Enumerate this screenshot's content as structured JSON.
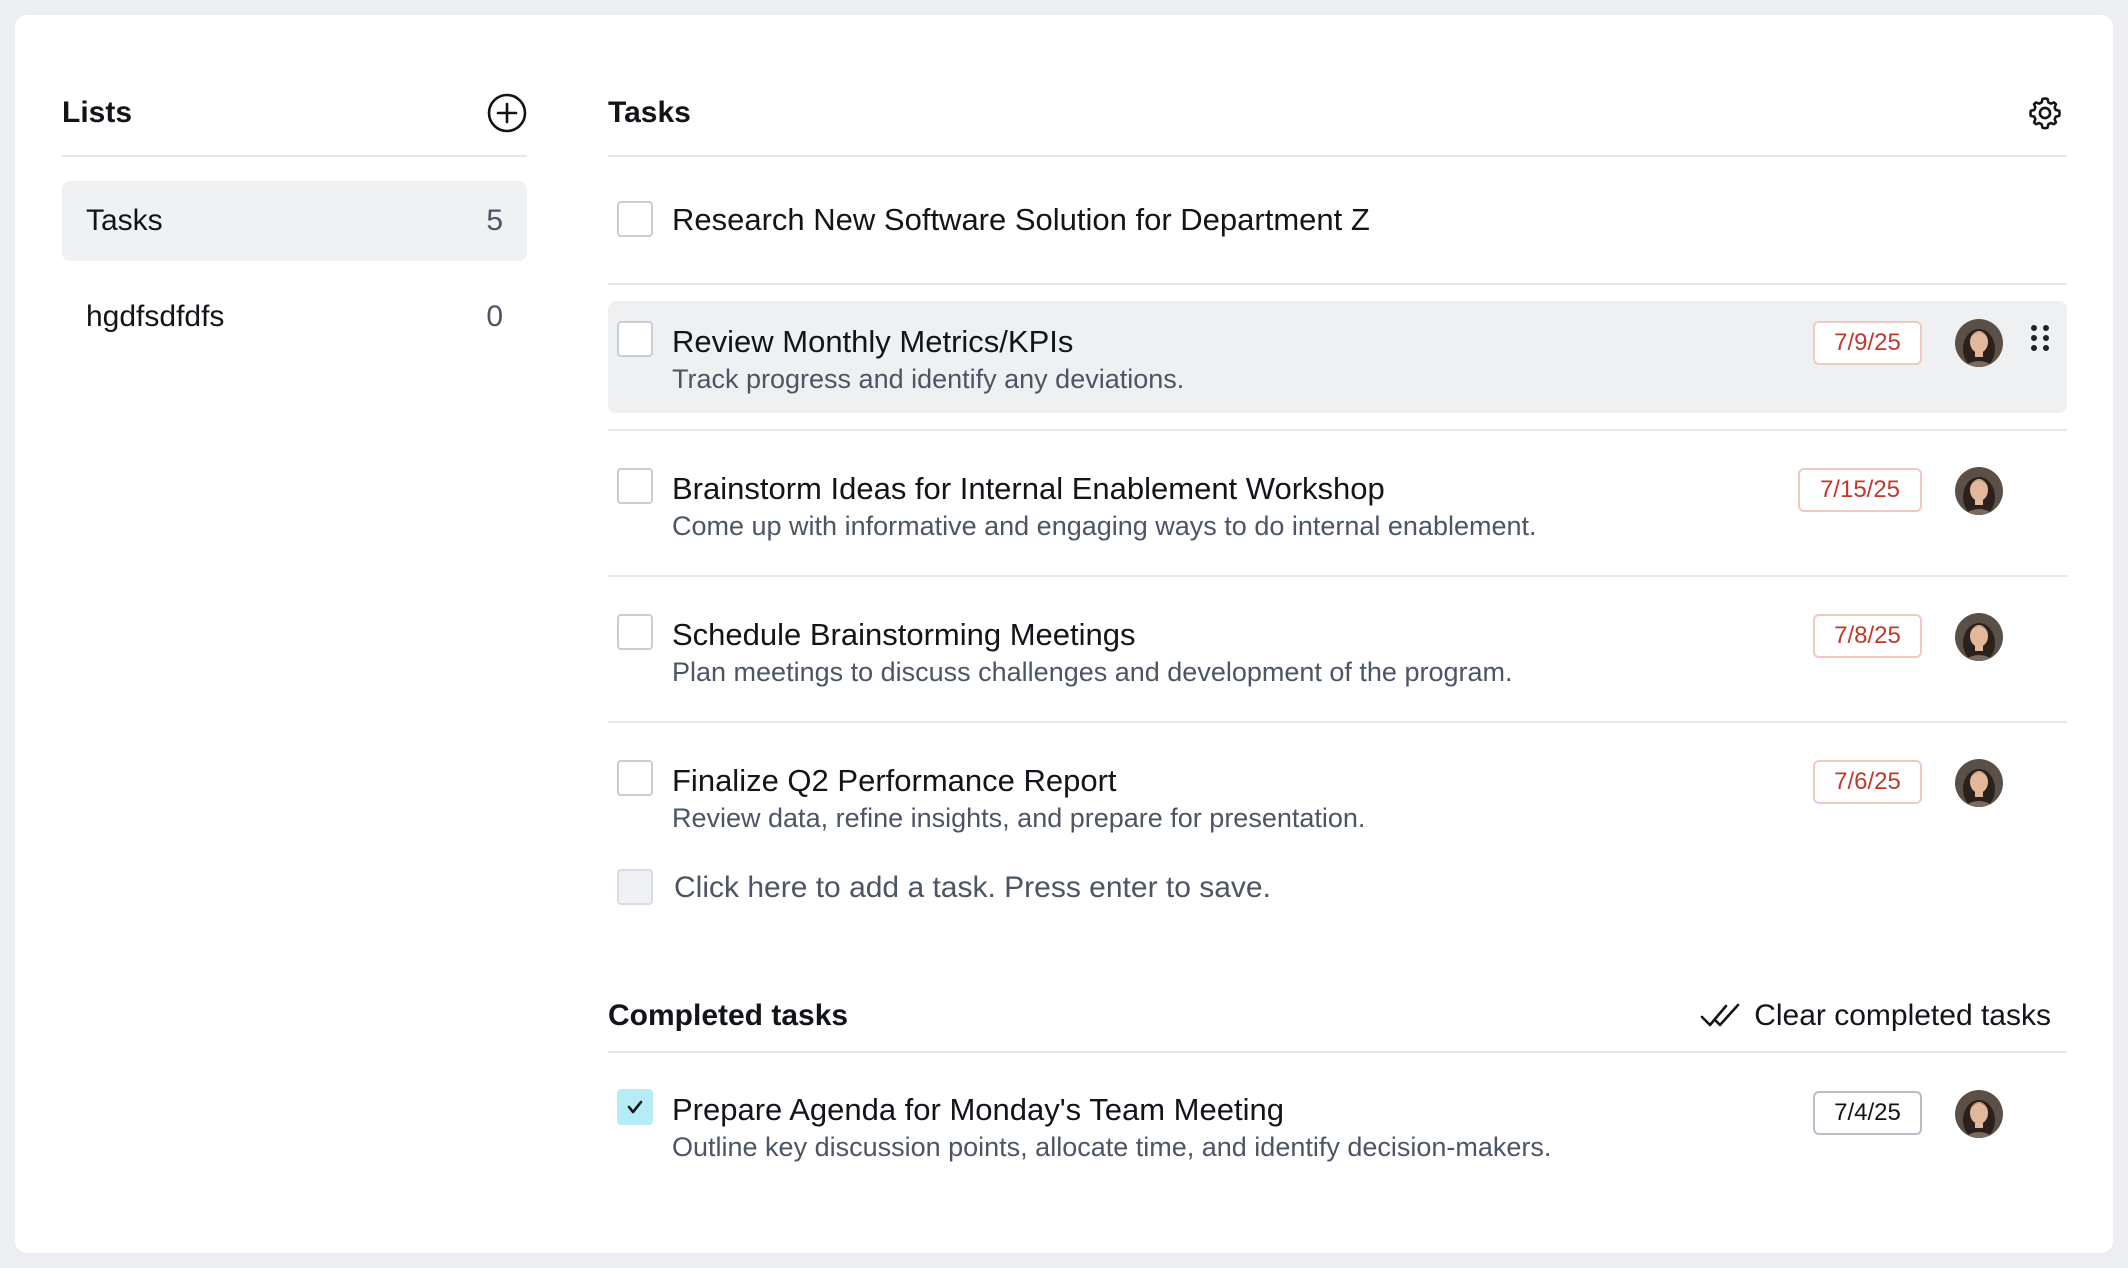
{
  "sidebar": {
    "title": "Lists",
    "add_icon": "plus-circle-icon",
    "items": [
      {
        "label": "Tasks",
        "count": "5",
        "active": true
      },
      {
        "label": "hgdfsdfdfs",
        "count": "0",
        "active": false
      }
    ]
  },
  "main": {
    "title": "Tasks",
    "settings_icon": "gear-icon",
    "tasks": [
      {
        "title": "Research New Software Solution for Department Z",
        "description": "",
        "due": "",
        "completed": false
      },
      {
        "title": "Review Monthly Metrics/KPIs",
        "description": "Track progress and identify any deviations.",
        "due": "7/9/25",
        "completed": false,
        "hovered": true
      },
      {
        "title": "Brainstorm Ideas for Internal Enablement Workshop",
        "description": "Come up with informative and engaging ways to do internal enablement.",
        "due": "7/15/25",
        "completed": false
      },
      {
        "title": "Schedule Brainstorming Meetings",
        "description": "Plan meetings to discuss challenges and development of the program.",
        "due": "7/8/25",
        "completed": false
      },
      {
        "title": "Finalize Q2 Performance Report",
        "description": "Review data, refine insights, and prepare for presentation.",
        "due": "7/6/25",
        "completed": false
      }
    ],
    "add_task_placeholder": "Click here to add a task. Press enter to save.",
    "completed": {
      "title": "Completed tasks",
      "clear_label": "Clear completed tasks",
      "clear_icon": "double-check-icon",
      "tasks": [
        {
          "title": "Prepare Agenda for Monday's Team Meeting",
          "description": "Outline key discussion points, allocate time, and identify decision-makers.",
          "due": "7/4/25",
          "completed": true
        }
      ]
    }
  },
  "colors": {
    "background": "#eceef1",
    "card": "#ffffff",
    "overdue_text": "#c0392b",
    "overdue_border": "#f2c9c2",
    "checked_fill": "#b5ecf5",
    "hover_row": "#eff0f2"
  }
}
